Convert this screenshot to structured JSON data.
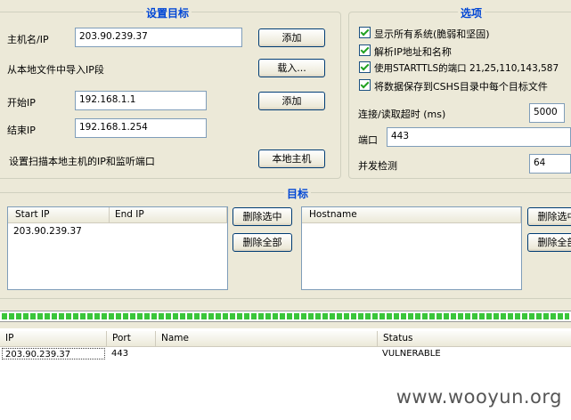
{
  "set_target": {
    "title": "设置目标",
    "hostname_label": "主机名/IP",
    "hostname_value": "203.90.239.37",
    "add_label": "添加",
    "import_label": "从本地文件中导入IP段",
    "load_label": "载入...",
    "start_ip_label": "开始IP",
    "start_ip_value": "192.168.1.1",
    "add2_label": "添加",
    "end_ip_label": "结束IP",
    "end_ip_value": "192.168.1.254",
    "local_scan_label": "设置扫描本地主机的IP和监听端口",
    "local_host_label": "本地主机"
  },
  "options": {
    "title": "选项",
    "checkboxes": [
      {
        "label": "显示所有系统(脆弱和坚固)",
        "checked": true
      },
      {
        "label": "解析IP地址和名称",
        "checked": true
      },
      {
        "label": "使用STARTTLS的端口 21,25,110,143,587",
        "checked": true
      },
      {
        "label": "将数据保存到CSHS目录中每个目标文件",
        "checked": true
      }
    ],
    "timeout_label": "连接/读取超时 (ms)",
    "timeout_value": "5000",
    "port_label": "端口",
    "port_value": "443",
    "concurrency_label": "并发检测",
    "concurrency_value": "64"
  },
  "targets": {
    "title": "目标",
    "ip_columns": [
      "Start IP",
      "End IP"
    ],
    "ip_rows": [
      [
        "203.90.239.37",
        ""
      ]
    ],
    "delete_selected_label": "删除选中",
    "delete_all_label": "删除全部",
    "host_columns": [
      "Hostname"
    ],
    "delete_selected2_label": "删除选中",
    "delete_all2_label": "删除全部"
  },
  "progress": {
    "value": 1.0,
    "color": "#3ac53a"
  },
  "results": {
    "columns": [
      "IP",
      "Port",
      "Name",
      "Status"
    ],
    "rows": [
      [
        "203.90.239.37",
        "443",
        "",
        "VULNERABLE"
      ]
    ]
  },
  "watermark": "www.wooyun.org",
  "colors": {
    "accent": "#0046d5",
    "window_bg": "#ece9d8",
    "check": "#21a121"
  }
}
